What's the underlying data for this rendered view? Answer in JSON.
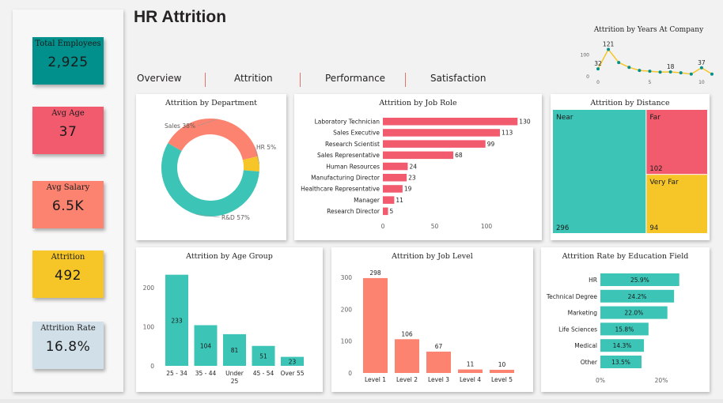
{
  "page_title": "HR Attrition",
  "nav": [
    "Overview",
    "Attrition",
    "Performance",
    "Satisfaction"
  ],
  "kpis": [
    {
      "label": "Total Employees",
      "value": "2,925",
      "color": "#01908c",
      "text_color": "#1a1a1a"
    },
    {
      "label": "Avg Age",
      "value": "37",
      "color": "#f25b6e",
      "text_color": "#1a1a1a"
    },
    {
      "label": "Avg Salary",
      "value": "6.5K",
      "color": "#fc8370",
      "text_color": "#1a1a1a"
    },
    {
      "label": "Attrition",
      "value": "492",
      "color": "#f6c629",
      "text_color": "#1a1a1a"
    },
    {
      "label": "Attrition Rate",
      "value": "16.8%",
      "color": "#d0dfe8",
      "text_color": "#1a1a1a"
    }
  ],
  "colors": {
    "teal": "#3cc4b6",
    "pink": "#f25b6e",
    "salmon": "#fc8370",
    "yellow": "#f6c629",
    "line": "#f6c629",
    "marker": "#01908c"
  },
  "chart_data": [
    {
      "type": "line",
      "title": "Attrition by Years At Company",
      "x": [
        0,
        1,
        2,
        3,
        4,
        5,
        6,
        7,
        8,
        9,
        10,
        11
      ],
      "values": [
        32,
        121,
        61,
        39,
        25,
        21,
        17,
        18,
        14,
        8,
        37,
        8
      ],
      "data_labels": {
        "0": "32",
        "1": "121",
        "7": "18",
        "10": "37"
      },
      "yticks": [
        "0",
        "100"
      ],
      "xticks": [
        "0",
        "5",
        "10"
      ]
    },
    {
      "type": "pie",
      "title": "Attrition by Department",
      "categories": [
        "Sales",
        "HR",
        "R&D"
      ],
      "values": [
        38,
        5,
        57
      ],
      "labels": [
        "Sales 38%",
        "HR 5%",
        "R&D 57%"
      ]
    },
    {
      "type": "bar",
      "title": "Attrition by Job Role",
      "categories": [
        "Laboratory Technician",
        "Sales Executive",
        "Research Scientist",
        "Sales Representative",
        "Human Resources",
        "Manufacturing Director",
        "Healthcare Representative",
        "Manager",
        "Research Director"
      ],
      "values": [
        130,
        113,
        99,
        68,
        24,
        23,
        19,
        11,
        5
      ],
      "xticks": [
        "0",
        "50",
        "100"
      ]
    },
    {
      "type": "heatmap",
      "title": "Attrition by Distance",
      "categories": [
        "Near",
        "Far",
        "Very Far"
      ],
      "values": [
        296,
        102,
        94
      ]
    },
    {
      "type": "bar",
      "title": "Attrition by Age Group",
      "categories": [
        "25 - 34",
        "35 - 44",
        "Under 25",
        "45 - 54",
        "Over 55"
      ],
      "values": [
        233,
        104,
        81,
        51,
        23
      ],
      "yticks": [
        "0",
        "100",
        "200"
      ]
    },
    {
      "type": "bar",
      "title": "Attrition by Job Level",
      "categories": [
        "Level 1",
        "Level 2",
        "Level 3",
        "Level 4",
        "Level 5"
      ],
      "values": [
        298,
        106,
        67,
        11,
        10
      ],
      "yticks": [
        "0",
        "100",
        "200",
        "300"
      ]
    },
    {
      "type": "bar",
      "title": "Attrition Rate by Education Field",
      "categories": [
        "HR",
        "Technical Degree",
        "Marketing",
        "Life Sciences",
        "Medical",
        "Other"
      ],
      "values": [
        25.9,
        24.2,
        22.0,
        15.8,
        14.3,
        13.5
      ],
      "labels": [
        "25.9%",
        "24.2%",
        "22.0%",
        "15.8%",
        "14.3%",
        "13.5%"
      ],
      "xticks": [
        "0%",
        "20%"
      ]
    }
  ]
}
